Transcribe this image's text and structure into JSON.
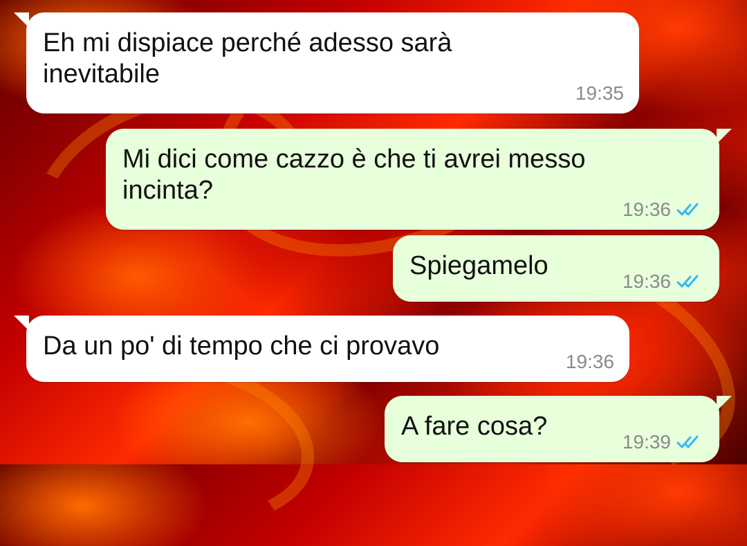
{
  "colors": {
    "incoming_bubble": "#ffffff",
    "outgoing_bubble": "#e7ffdb",
    "read_ticks": "#34b7f1",
    "timestamp": "#8a8a8a"
  },
  "messages": [
    {
      "direction": "incoming",
      "text": "Eh mi dispiace perché adesso sarà inevitabile",
      "time": "19:35"
    },
    {
      "direction": "outgoing",
      "text": "Mi dici come cazzo è che ti avrei messo incinta?",
      "time": "19:36",
      "status_icon": "double-check-read-icon"
    },
    {
      "direction": "outgoing",
      "text": "Spiegamelo",
      "time": "19:36",
      "status_icon": "double-check-read-icon"
    },
    {
      "direction": "incoming",
      "text": "Da un po' di tempo che ci provavo",
      "time": "19:36"
    },
    {
      "direction": "outgoing",
      "text": "A fare cosa?",
      "time": "19:39",
      "status_icon": "double-check-read-icon"
    }
  ]
}
